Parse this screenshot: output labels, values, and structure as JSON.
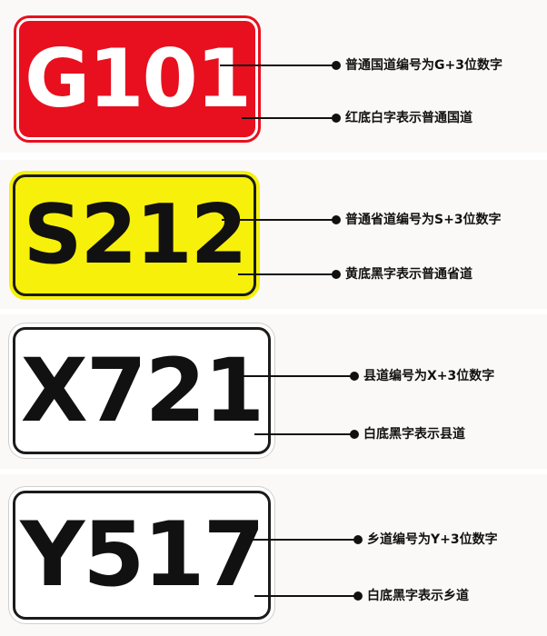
{
  "signs": [
    {
      "code": "G101",
      "color": "red",
      "background": "#e8101e",
      "text_color": "#ffffff",
      "annotations": [
        "普通国道编号为G+3位数字",
        "红底白字表示普通国道"
      ]
    },
    {
      "code": "S212",
      "color": "yellow",
      "background": "#f7f00a",
      "text_color": "#111111",
      "annotations": [
        "普通省道编号为S+3位数字",
        "黄底黑字表示普通省道"
      ]
    },
    {
      "code": "X721",
      "color": "white",
      "background": "#ffffff",
      "text_color": "#111111",
      "annotations": [
        "县道编号为X+3位数字",
        "白底黑字表示县道"
      ]
    },
    {
      "code": "Y517",
      "color": "white",
      "background": "#ffffff",
      "text_color": "#111111",
      "annotations": [
        "乡道编号为Y+3位数字",
        "白底黑字表示乡道"
      ]
    }
  ]
}
